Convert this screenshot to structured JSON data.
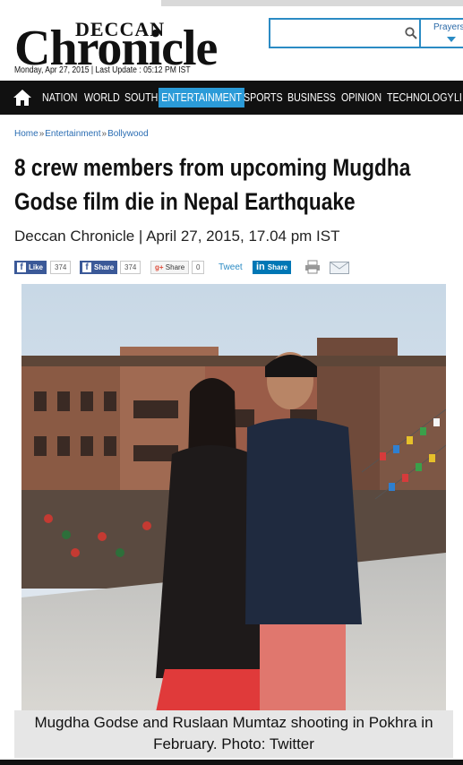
{
  "header": {
    "logo_top": "DECCAN",
    "logo_main": "Chronicle",
    "dateline": "Monday, Apr 27, 2015 | Last Update : 05:12 PM IST",
    "search": {
      "placeholder": "",
      "icon": "search-icon"
    },
    "prayers": {
      "label": "Prayers"
    }
  },
  "nav": {
    "home_icon": "home-icon",
    "items": [
      {
        "label": "NATION"
      },
      {
        "label": "WORLD"
      },
      {
        "label": "SOUTH"
      },
      {
        "label": "ENTERTAINMENT",
        "active": true
      },
      {
        "label": "SPORTS"
      },
      {
        "label": "BUSINESS"
      },
      {
        "label": "OPINION"
      },
      {
        "label": "TECHNOLOGY"
      },
      {
        "label": "LI"
      }
    ],
    "active_color": "#2b9bd8"
  },
  "breadcrumb": [
    "Home",
    "Entertainment",
    "Bollywood"
  ],
  "article": {
    "headline": "8 crew members from upcoming Mugdha Godse film die in Nepal Earthquake",
    "byline": "Deccan Chronicle | April 27, 2015, 17.04 pm IST",
    "caption": "Mugdha Godse and Ruslaan Mumtaz shooting in Pokhra in February. Photo: Twitter"
  },
  "social": {
    "like_label": "Like",
    "like_count": "374",
    "share_label": "Share",
    "share_count": "374",
    "gplus_label": "Share",
    "gplus_count": "0",
    "tweet_label": "Tweet",
    "linkedin_label": "Share",
    "print_icon": "print-icon",
    "email_icon": "email-icon"
  },
  "colors": {
    "brand_blue": "#2b8bc4",
    "facebook": "#3b5998",
    "linkedin": "#0077b5",
    "nav_bg": "#111111"
  }
}
